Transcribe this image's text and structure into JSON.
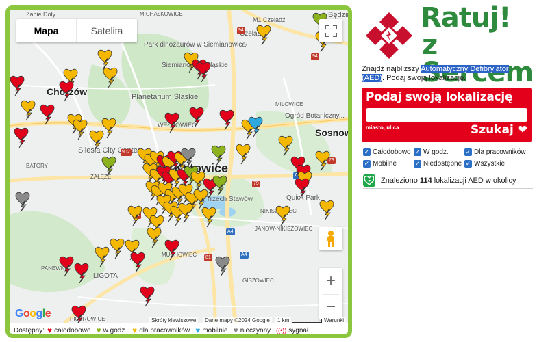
{
  "map": {
    "type_buttons": [
      "Mapa",
      "Satelita"
    ],
    "places": [
      {
        "name": "Zabie Doły",
        "top": true
      },
      {
        "name": "MICHAŁKOWICE"
      },
      {
        "name": "M1 Czeladź"
      },
      {
        "name": "Będzin"
      },
      {
        "name": "Czeladź"
      },
      {
        "name": "Park dinozaurów w Siemianowicach Śląskich"
      },
      {
        "name": "Siemianowice Śląskie"
      },
      {
        "name": "Chorzów"
      },
      {
        "name": "Planetarium Śląskie"
      },
      {
        "name": "MILOWICE"
      },
      {
        "name": "Ogród Botaniczny..."
      },
      {
        "name": "Sosnowiec"
      },
      {
        "name": "WEŁNOWIEC"
      },
      {
        "name": "Silesia City Center"
      },
      {
        "name": "Katowice"
      },
      {
        "name": "BATORY"
      },
      {
        "name": "ZAŁĘŻE"
      },
      {
        "name": "Dolina Trzech Stawów"
      },
      {
        "name": "Quick Park"
      },
      {
        "name": "NIKISZOWIEC"
      },
      {
        "name": "JANÓW-NIKISZOWIEC"
      },
      {
        "name": "MUCHOWIEC"
      },
      {
        "name": "PANEWNIKI"
      },
      {
        "name": "LIGOTA"
      },
      {
        "name": "GISZOWIEC"
      },
      {
        "name": "PIOTROWICE"
      }
    ],
    "road_badges": [
      "94",
      "94",
      "902",
      "79",
      "79",
      "A4",
      "A4",
      "81",
      "86",
      "A1"
    ],
    "attribution": {
      "shortcuts": "Skróty klawiszowe",
      "data": "Dane mapy ©2024 Google",
      "scale": "1 km",
      "terms": "Warunki"
    },
    "google": "Google"
  },
  "legend": {
    "label": "Dostępny:",
    "items": [
      {
        "label": "całodobowo",
        "color": "#e3001b"
      },
      {
        "label": "w godz.",
        "color": "#8cb31e"
      },
      {
        "label": "dla pracowników",
        "color": "#f5b800"
      },
      {
        "label": "mobilnie",
        "color": "#2ea9e0"
      },
      {
        "label": "nieczynny",
        "color": "#8a8a8a"
      },
      {
        "label": "sygnał",
        "color": "#e3001b"
      }
    ]
  },
  "logo": {
    "line1": "Ratuj",
    "line2": "z Sercem",
    "exclaim": "!"
  },
  "tagline": {
    "pre": "Znajdź najbliższy ",
    "highlight1": "Automatyczny Defibrylator",
    "highlight2": "(AED)",
    "post": ". Podaj swoją lokalizację."
  },
  "search": {
    "title": "Podaj swoją lokalizację",
    "placeholder": "",
    "hint": "miasto, ulica",
    "button": "Szukaj"
  },
  "filters": [
    [
      "Całodobowo",
      "W godz.",
      "Dla pracowników"
    ],
    [
      "Mobilne",
      "Niedostępne",
      "Wszystkie"
    ]
  ],
  "result": {
    "pre": "Znaleziono ",
    "count": "114",
    "post": " lokalizacji AED w okolicy"
  }
}
